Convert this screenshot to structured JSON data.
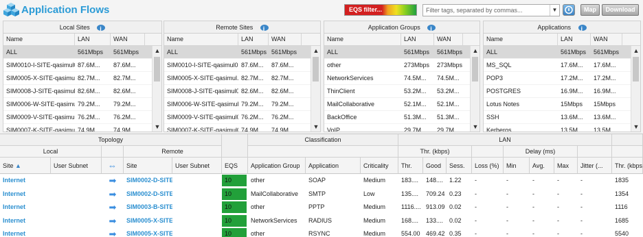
{
  "app": {
    "title": "Application Flows"
  },
  "toolbar": {
    "eqs_filter_label": "EQS filter...",
    "tag_placeholder": "Filter tags, separated by commas...",
    "map_label": "Map",
    "download_label": "Download"
  },
  "panels": [
    {
      "title": "Local Sites",
      "headers": [
        "Name",
        "LAN",
        "WAN"
      ],
      "rows": [
        [
          "ALL",
          "561Mbps",
          "561Mbps"
        ],
        [
          "SIM0010-I-SITE-qasimul01",
          "87.6M...",
          "87.6M..."
        ],
        [
          "SIM0005-X-SITE-qasimul01",
          "82.7M...",
          "82.7M..."
        ],
        [
          "SIM0008-J-SITE-qasimul01",
          "82.6M...",
          "82.6M..."
        ],
        [
          "SIM0006-W-SITE-qasimu...",
          "79.2M...",
          "79.2M..."
        ],
        [
          "SIM0009-V-SITE-qasimul01",
          "76.2M...",
          "76.2M..."
        ],
        [
          "SIM0007-K-SITE-qasimul01",
          "74.9M",
          "74.9M"
        ]
      ]
    },
    {
      "title": "Remote Sites",
      "headers": [
        "Name",
        "LAN",
        "WAN"
      ],
      "rows": [
        [
          "ALL",
          "561Mbps",
          "561Mbps"
        ],
        [
          "SIM0010-I-SITE-qasimul01",
          "87.6M...",
          "87.6M..."
        ],
        [
          "SIM0005-X-SITE-qasimul...",
          "82.7M...",
          "82.7M..."
        ],
        [
          "SIM0008-J-SITE-qasimul01",
          "82.6M...",
          "82.6M..."
        ],
        [
          "SIM0006-W-SITE-qasimul01",
          "79.2M...",
          "79.2M..."
        ],
        [
          "SIM0009-V-SITE-qasimul01",
          "76.2M...",
          "76.2M..."
        ],
        [
          "SIM0007-K-SITE-qasimul01",
          "74.9M",
          "74.9M"
        ]
      ]
    },
    {
      "title": "Application Groups",
      "headers": [
        "Name",
        "LAN",
        "WAN"
      ],
      "rows": [
        [
          "ALL",
          "561Mbps",
          "561Mbps"
        ],
        [
          "other",
          "273Mbps",
          "273Mbps"
        ],
        [
          "NetworkServices",
          "74.5M...",
          "74.5M..."
        ],
        [
          "ThinClient",
          "53.2M...",
          "53.2M..."
        ],
        [
          "MailCollaborative",
          "52.1M...",
          "52.1M..."
        ],
        [
          "BackOffice",
          "51.3M...",
          "51.3M..."
        ],
        [
          "VoIP",
          "29.7M",
          "29.7M"
        ]
      ]
    },
    {
      "title": "Applications",
      "headers": [
        "Name",
        "LAN",
        "WAN"
      ],
      "rows": [
        [
          "ALL",
          "561Mbps",
          "561Mbps"
        ],
        [
          "MS_SQL",
          "17.6M...",
          "17.6M..."
        ],
        [
          "POP3",
          "17.2M...",
          "17.2M..."
        ],
        [
          "POSTGRES",
          "16.9M...",
          "16.9M..."
        ],
        [
          "Lotus Notes",
          "15Mbps",
          "15Mbps"
        ],
        [
          "SSH",
          "13.6M...",
          "13.6M..."
        ],
        [
          "Kerberos",
          "13.5M",
          "13.5M"
        ]
      ]
    }
  ],
  "flows": {
    "groups": {
      "topology": "Topology",
      "classification": "Classification",
      "lan": "LAN"
    },
    "subgroups": {
      "local": "Local",
      "remote": "Remote",
      "thr": "Thr. (kbps)",
      "delay": "Delay (ms)"
    },
    "columns": {
      "site": "Site",
      "user_subnet": "User Subnet",
      "r_site": "Site",
      "r_user_subnet": "User Subnet",
      "eqs": "EQS",
      "app_group": "Application Group",
      "application": "Application",
      "criticality": "Criticality",
      "thr": "Thr.",
      "good": "Good",
      "sess": "Sess.",
      "loss": "Loss (%)",
      "min": "Min",
      "avg": "Avg.",
      "max": "Max",
      "jitter": "Jitter (...",
      "thr2": "Thr. (kbps"
    },
    "rows": [
      {
        "site": "Internet",
        "remote": "SIM0002-D-SITE",
        "eqs": "10",
        "group": "other",
        "app": "SOAP",
        "crit": "Medium",
        "thr": "183....",
        "good": "148....",
        "sess": "1.22",
        "loss": "-",
        "min": "-",
        "avg": "-",
        "max": "-",
        "jitter": "-",
        "thr2": "1835"
      },
      {
        "site": "Internet",
        "remote": "SIM0002-D-SITE",
        "eqs": "10",
        "group": "MailCollaborative",
        "app": "SMTP",
        "crit": "Low",
        "thr": "135....",
        "good": "709.24",
        "sess": "0.23",
        "loss": "-",
        "min": "-",
        "avg": "-",
        "max": "-",
        "jitter": "-",
        "thr2": "1354"
      },
      {
        "site": "Internet",
        "remote": "SIM0003-B-SITE",
        "eqs": "10",
        "group": "other",
        "app": "PPTP",
        "crit": "Medium",
        "thr": "1116....",
        "good": "913.09",
        "sess": "0.02",
        "loss": "-",
        "min": "-",
        "avg": "-",
        "max": "-",
        "jitter": "-",
        "thr2": "1116"
      },
      {
        "site": "Internet",
        "remote": "SIM0005-X-SITE",
        "eqs": "10",
        "group": "NetworkServices",
        "app": "RADIUS",
        "crit": "Medium",
        "thr": "168....",
        "good": "133....",
        "sess": "0.02",
        "loss": "-",
        "min": "-",
        "avg": "-",
        "max": "-",
        "jitter": "-",
        "thr2": "1685"
      },
      {
        "site": "Internet",
        "remote": "SIM0005-X-SITE",
        "eqs": "10",
        "group": "other",
        "app": "RSYNC",
        "crit": "Medium",
        "thr": "554.00",
        "good": "469.42",
        "sess": "0.35",
        "loss": "-",
        "min": "-",
        "avg": "-",
        "max": "-",
        "jitter": "-",
        "thr2": "5540"
      }
    ]
  }
}
